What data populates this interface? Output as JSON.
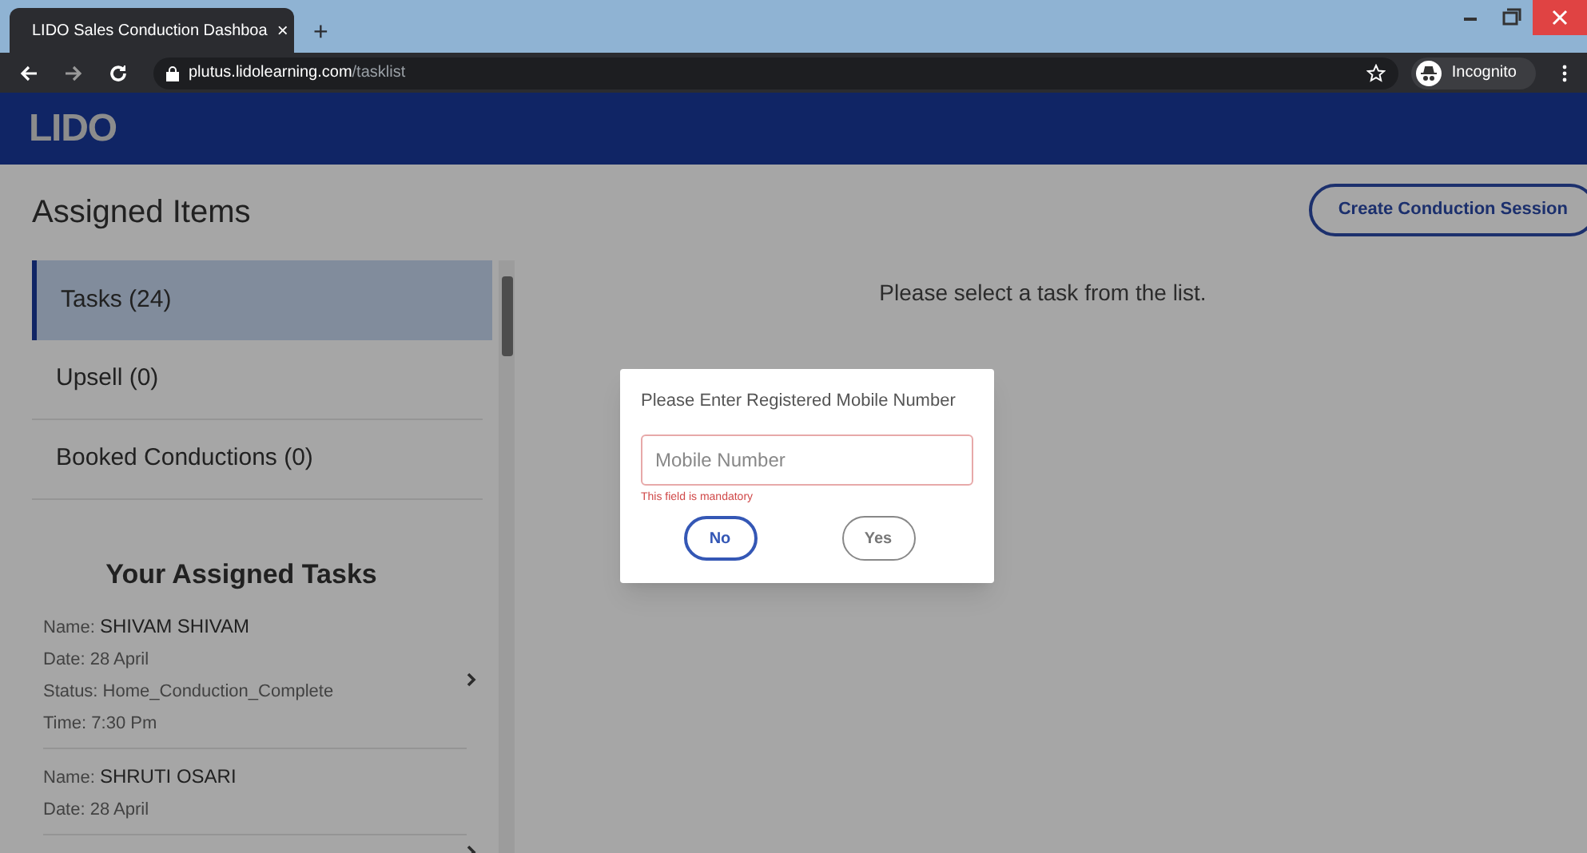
{
  "browser": {
    "tab_title": "LIDO Sales Conduction Dashboa",
    "tab_close": "×",
    "new_tab": "+",
    "url_host": "plutus.lidolearning.com",
    "url_path": "/tasklist",
    "profile": "Incognito"
  },
  "header": {
    "logo": "LIDO"
  },
  "sidebar": {
    "title": "Assigned Items",
    "items": [
      {
        "label": "Tasks (24)",
        "selected": true
      },
      {
        "label": "Upsell (0)",
        "selected": false
      },
      {
        "label": "Booked Conductions (0)",
        "selected": false
      }
    ],
    "tasks_title": "Your Assigned Tasks",
    "tasks": [
      {
        "name_label": "Name:",
        "name": "SHIVAM SHIVAM",
        "date": "Date: 28 April",
        "status": "Status: Home_Conduction_Complete",
        "time": "Time: 7:30 Pm"
      },
      {
        "name_label": "Name:",
        "name": "SHRUTI OSARI",
        "date": "Date: 28 April"
      }
    ]
  },
  "main": {
    "create_button": "Create Conduction Session",
    "empty_message": "Please select a task from the list."
  },
  "dialog": {
    "title": "Please Enter Registered Mobile Number",
    "field": {
      "placeholder": "Mobile Number"
    },
    "error": "This field is mandatory",
    "buttons": [
      {
        "label": "No",
        "selected": true
      },
      {
        "label": "Yes",
        "selected": false
      }
    ]
  }
}
